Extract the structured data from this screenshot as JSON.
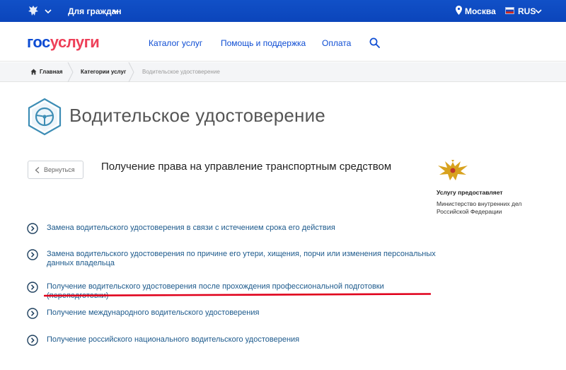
{
  "topbar": {
    "audience": "Для граждан",
    "city": "Москва",
    "language": "RUS"
  },
  "header": {
    "logo_part1": "гос",
    "logo_part2": "услуги",
    "nav": [
      "Каталог услуг",
      "Помощь и поддержка",
      "Оплата"
    ]
  },
  "breadcrumb": {
    "home": "Главная",
    "categories": "Категории услуг",
    "current": "Водительское удостоверение"
  },
  "page": {
    "title": "Водительское удостоверение",
    "back_label": "Вернуться",
    "service_heading": "Получение права на управление транспортным средством"
  },
  "provider": {
    "label": "Услугу предоставляет",
    "name": "Министерство внутренних дел Российской Федерации"
  },
  "services": [
    "Замена водительского удостоверения в связи с истечением срока его действия",
    "Замена водительского удостоверения по причине его утери, хищения, порчи или изменения персональных данных владельца",
    "Получение водительского удостоверения после прохождения профессиональной подготовки (переподготовки)",
    "Получение международного водительского удостоверения",
    "Получение российского национального водительского удостоверения"
  ],
  "colors": {
    "brand_blue": "#0d4cd3",
    "brand_red": "#ee3f58",
    "link_blue": "#1d5a8c",
    "highlight_red": "#e0001b"
  }
}
